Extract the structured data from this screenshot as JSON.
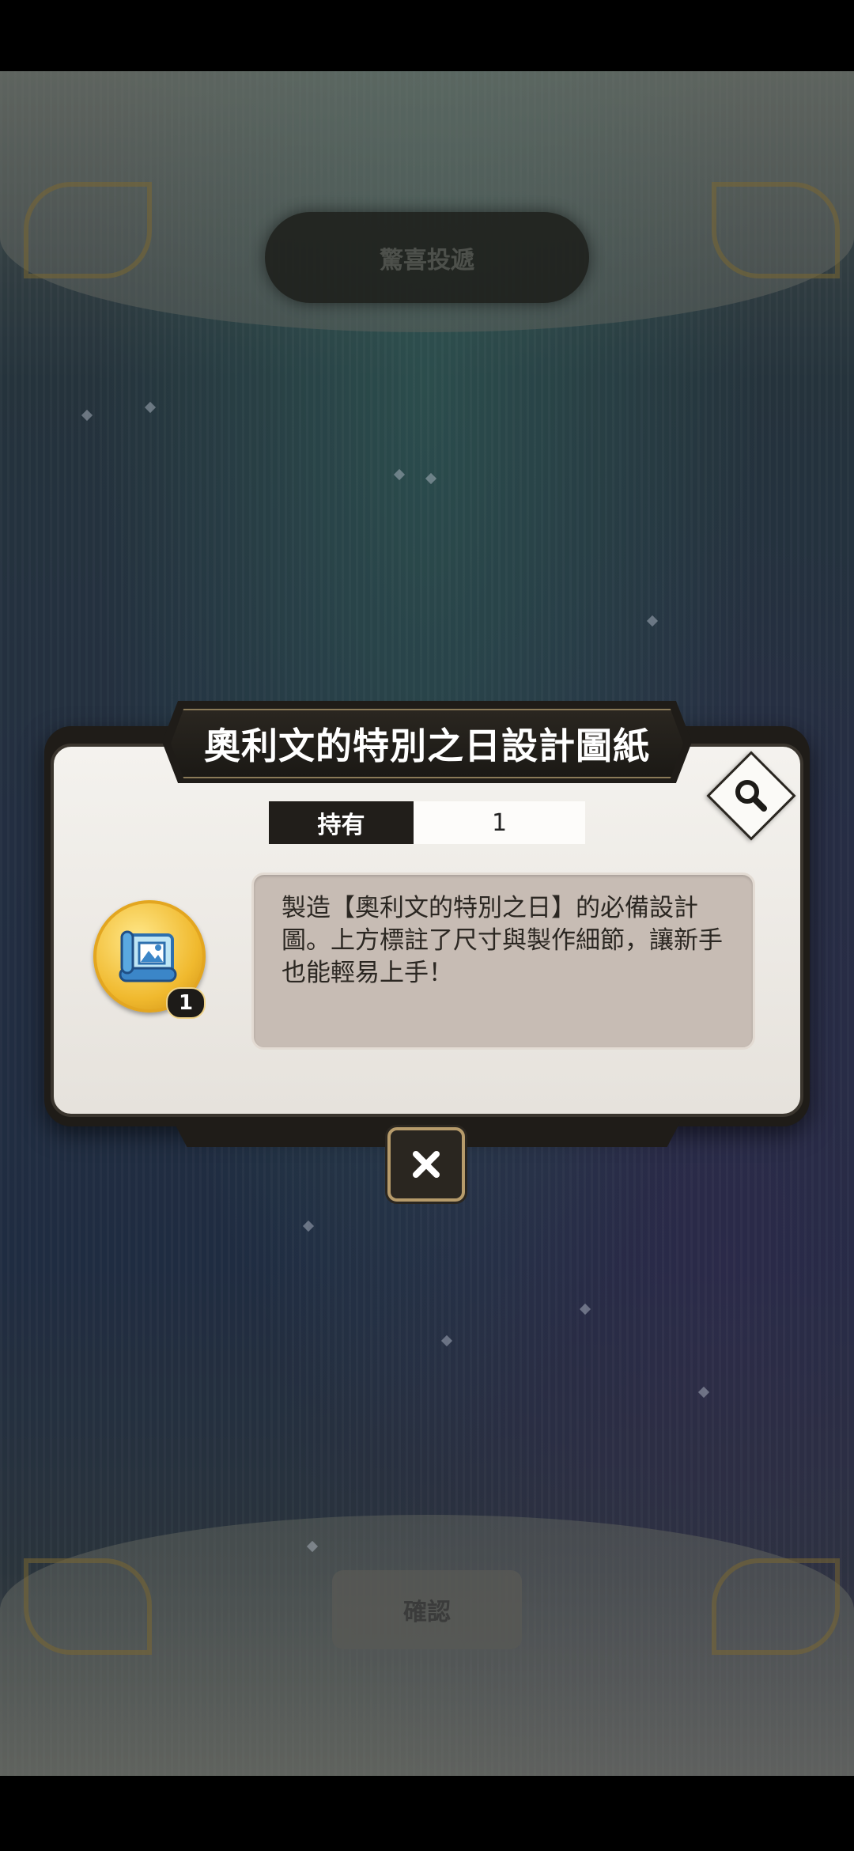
{
  "background": {
    "banner_title": "驚喜投遞",
    "bottom_button_label": "確認"
  },
  "dialog": {
    "title": "奧利文的特別之日設計圖紙",
    "owned_label": "持有",
    "owned_value": "1",
    "item": {
      "icon": "blueprint-scroll-icon",
      "count_badge": "1"
    },
    "description": "製造【奧利文的特別之日】的必備設計圖。上方標註了尺寸與製作細節，讓新手也能輕易上手！",
    "zoom_icon": "magnifier-icon",
    "close_icon": "close-icon"
  },
  "colors": {
    "dialog_dark": "#1f1c18",
    "dialog_light": "#f4f2ee",
    "description_bg": "#c7bcb4",
    "gold_accent": "#f0b92e"
  }
}
